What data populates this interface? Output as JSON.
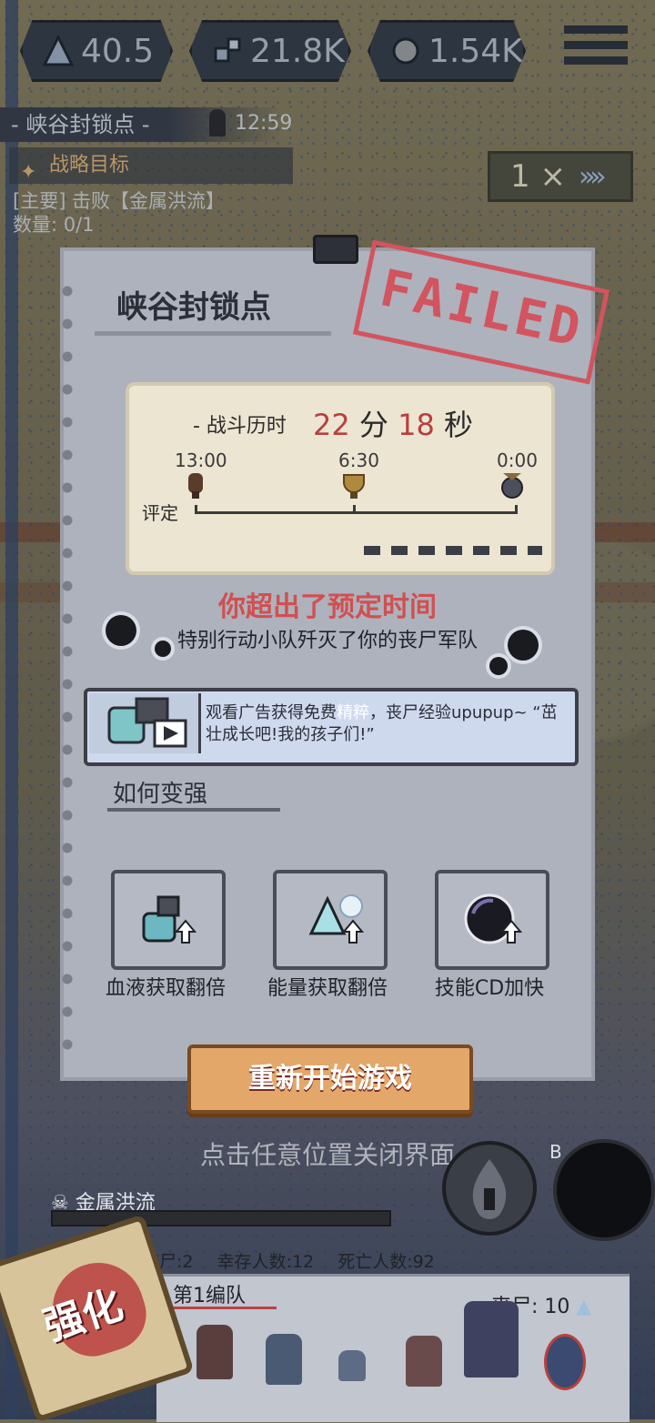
{
  "resources": [
    {
      "icon": "energy-icon",
      "value": "40.5"
    },
    {
      "icon": "blood-icon",
      "value": "21.8K"
    },
    {
      "icon": "bone-icon",
      "value": "1.54K"
    }
  ],
  "map": {
    "location": "- 峡谷封锁点 -",
    "timer": "12:59",
    "objective_header": "战略目标",
    "objective_line1": "[主要] 击败【金属洪流】",
    "objective_line2": "数量: 0/1",
    "speed": "1 ×",
    "speed_arrows": "»»"
  },
  "result": {
    "title": "峡谷封锁点",
    "stamp": "FAILED",
    "battle_time_label": "- 战斗历时",
    "minutes": "22",
    "min_unit": "分",
    "seconds": "18",
    "sec_unit": "秒",
    "ticks": [
      "13:00",
      "6:30",
      "0:00"
    ],
    "grade_label": "评定",
    "fail_message": "你超出了预定时间",
    "fail_sub": "特别行动小队歼灭了你的丧尸军队",
    "ad_text_a": "观看广告获得免费",
    "ad_text_highlight": "精粹",
    "ad_text_b": "，丧尸经验upupup~ “茁壮成长吧!我的孩子们!”",
    "howto": "如何变强",
    "tips": [
      "血液获取翻倍",
      "能量获取翻倍",
      "技能CD加快"
    ],
    "restart": "重新开始游戏",
    "close_hint": "点击任意位置关闭界面"
  },
  "hud": {
    "boss_name": "金属洪流",
    "skill_b_key": "B",
    "stats": [
      "丧尸:2",
      "幸存人数:12",
      "死亡人数:92"
    ],
    "team_name": "第1编队",
    "team_count": "丧尸: 10",
    "upgrade": "强化"
  },
  "colors": {
    "failed": "#d2545e",
    "time_number": "#b8403e",
    "restart_button": "#e3a869",
    "card": "#aeb2bd"
  }
}
